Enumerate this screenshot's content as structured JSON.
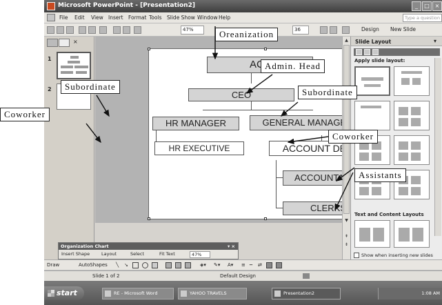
{
  "window": {
    "title": "Microsoft PowerPoint - [Presentation2]"
  },
  "menu": {
    "items": [
      "File",
      "Edit",
      "View",
      "Insert",
      "Format",
      "Tools",
      "Slide Show",
      "Window",
      "Help"
    ],
    "help_placeholder": "Type a question for help"
  },
  "toolbar": {
    "zoom": "47%",
    "font_size": "36",
    "design_label": "Design",
    "new_slide_label": "New Slide"
  },
  "slides_pane": {
    "numbers": [
      "1",
      "2"
    ]
  },
  "org_chart": {
    "nodes": {
      "act": "ACT",
      "ceo": "CEO",
      "hr_manager": "HR MANAGER",
      "general_manager": "GENERAL MANAGER",
      "hr_executive": "HR EXECUTIVE",
      "account_dept": "ACCOUNT DEPT.",
      "accountants": "ACCOUNTANTS",
      "clerks": "CLERKS"
    }
  },
  "task_pane": {
    "title": "Slide Layout",
    "apply_label": "Apply slide layout:",
    "section2": "Text and Content Layouts",
    "checkbox_label": "Show when inserting new slides"
  },
  "org_toolbar": {
    "title": "Organization Chart",
    "insert_shape": "Insert Shape",
    "layout": "Layout",
    "select": "Select",
    "fit_text": "Fit Text",
    "zoom": "47%"
  },
  "drawing_toolbar": {
    "draw": "Draw",
    "autoshapes": "AutoShapes"
  },
  "status_bar": {
    "slide": "Slide 1 of 2",
    "design": "Default Design"
  },
  "taskbar": {
    "start": "start",
    "tasks": [
      "RE - Microsoft Word",
      "YAHOO TRAVELS",
      "Presentation2"
    ],
    "clock": "1:08 AM"
  },
  "annotations": {
    "organization": "Oreanization",
    "admin_head": "Admin. Head",
    "subordinate_left": "Subordinate",
    "subordinate_right": "Subordinate",
    "coworker_left": "Coworker",
    "coworker_right": "Coworker",
    "assistants": "Assistants"
  }
}
